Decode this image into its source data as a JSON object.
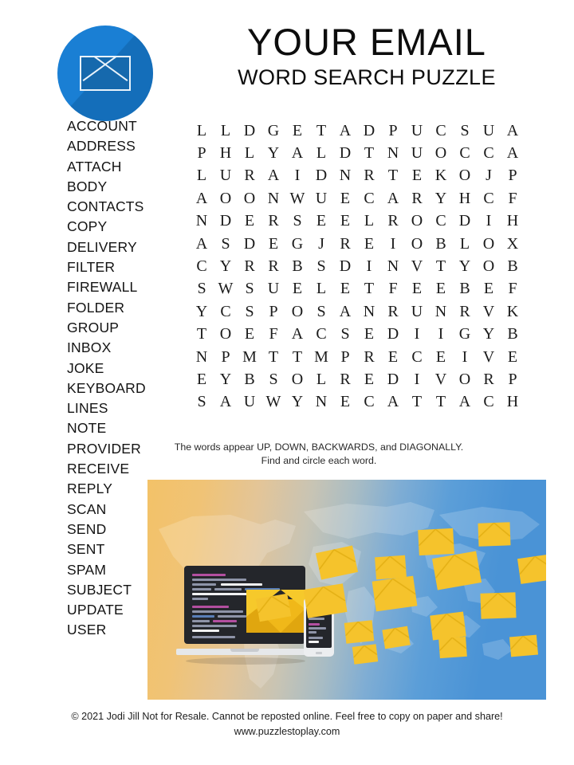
{
  "header": {
    "logo_icon": "envelope-icon",
    "title": "YOUR EMAIL",
    "subtitle": "WORD SEARCH PUZZLE",
    "accent_color": "#1a7fd4"
  },
  "wordlist": {
    "words": [
      "ACCOUNT",
      "ADDRESS",
      "ATTACH",
      "BODY",
      "CONTACTS",
      "COPY",
      "DELIVERY",
      "FILTER",
      "FIREWALL",
      "FOLDER",
      "GROUP",
      "INBOX",
      "JOKE",
      "KEYBOARD",
      "LINES",
      "NOTE",
      "PROVIDER",
      "RECEIVE",
      "REPLY",
      "SCAN",
      "SEND",
      "SENT",
      "SPAM",
      "SUBJECT",
      "UPDATE",
      "USER"
    ]
  },
  "grid": {
    "rows": 13,
    "cols": 14,
    "letters": [
      [
        "L",
        "L",
        "D",
        "G",
        "E",
        "T",
        "A",
        "D",
        "P",
        "U",
        "C",
        "S",
        "U",
        "A"
      ],
      [
        "P",
        "H",
        "L",
        "Y",
        "A",
        "L",
        "D",
        "T",
        "N",
        "U",
        "O",
        "C",
        "C",
        "A"
      ],
      [
        "L",
        "U",
        "R",
        "A",
        "I",
        "D",
        "N",
        "R",
        "T",
        "E",
        "K",
        "O",
        "J",
        "P"
      ],
      [
        "A",
        "O",
        "O",
        "N",
        "W",
        "U",
        "E",
        "C",
        "A",
        "R",
        "Y",
        "H",
        "C",
        "F"
      ],
      [
        "N",
        "D",
        "E",
        "R",
        "S",
        "E",
        "E",
        "L",
        "R",
        "O",
        "C",
        "D",
        "I",
        "H"
      ],
      [
        "A",
        "S",
        "D",
        "E",
        "G",
        "J",
        "R",
        "E",
        "I",
        "O",
        "B",
        "L",
        "O",
        "X"
      ],
      [
        "C",
        "Y",
        "R",
        "R",
        "B",
        "S",
        "D",
        "I",
        "N",
        "V",
        "T",
        "Y",
        "O",
        "B"
      ],
      [
        "S",
        "W",
        "S",
        "U",
        "E",
        "L",
        "E",
        "T",
        "F",
        "E",
        "E",
        "B",
        "E",
        "F"
      ],
      [
        "Y",
        "C",
        "S",
        "P",
        "O",
        "S",
        "A",
        "N",
        "R",
        "U",
        "N",
        "R",
        "V",
        "K"
      ],
      [
        "T",
        "O",
        "E",
        "F",
        "A",
        "C",
        "S",
        "E",
        "D",
        "I",
        "I",
        "G",
        "Y",
        "B"
      ],
      [
        "N",
        "P",
        "M",
        "T",
        "T",
        "M",
        "P",
        "R",
        "E",
        "C",
        "E",
        "I",
        "V",
        "E"
      ],
      [
        "E",
        "Y",
        "B",
        "S",
        "O",
        "L",
        "R",
        "E",
        "D",
        "I",
        "V",
        "O",
        "R",
        "P"
      ],
      [
        "S",
        "A",
        "U",
        "W",
        "Y",
        "N",
        "E",
        "C",
        "A",
        "T",
        "T",
        "A",
        "C",
        "H"
      ]
    ]
  },
  "instructions": {
    "line1": "The words appear UP, DOWN, BACKWARDS, and DIAGONALLY.",
    "line2": "Find and circle each word."
  },
  "illustration": {
    "alt": "Laptop and smartphone with flying yellow envelopes over a world map",
    "envelope_color": "#f5c32c",
    "map_colors": [
      "#f3c268",
      "#4a93d6"
    ]
  },
  "footer": {
    "copyright": "© 2021  Jodi Jill Not for Resale. Cannot be reposted online. Feel free to copy on paper and share!",
    "website": "www.puzzlestoplay.com"
  }
}
